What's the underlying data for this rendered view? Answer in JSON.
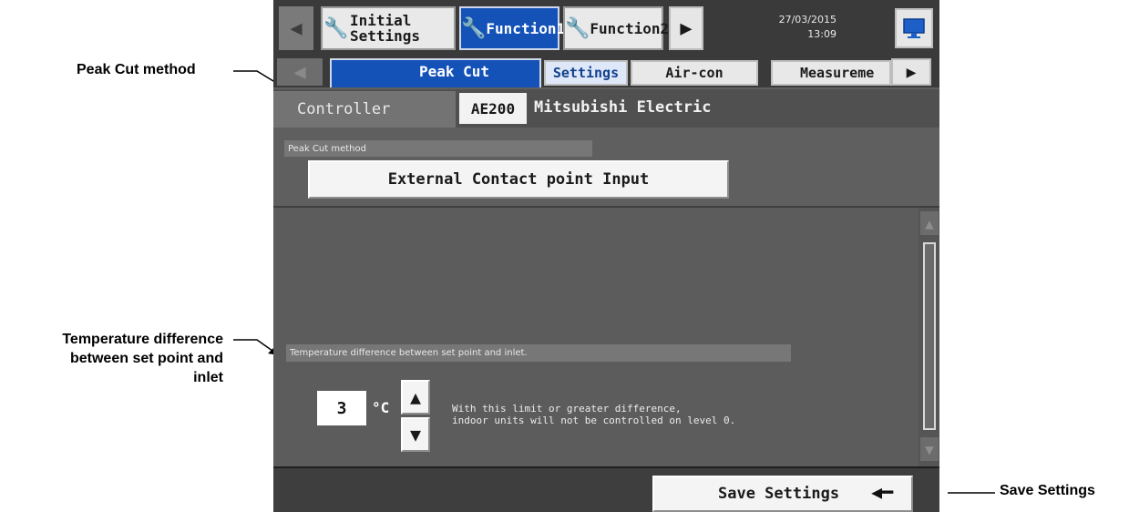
{
  "callouts": {
    "peak_cut_method": "Peak Cut method",
    "temperature_difference": [
      "Temperature difference",
      "between set point and",
      "inlet"
    ],
    "save_settings": "Save Settings"
  },
  "top_tabs": {
    "initial_settings": [
      "Initial",
      "Settings"
    ],
    "function1": "Function1",
    "function2": "Function2"
  },
  "datetime": {
    "date": "27/03/2015",
    "time": "13:09"
  },
  "sub_tabs": {
    "peak_cut": "Peak Cut",
    "settings": "Settings",
    "air_con": "Air-con",
    "measurement": "Measureme"
  },
  "controller": {
    "label": "Controller",
    "model": "AE200",
    "maker": "Mitsubishi Electric"
  },
  "peak_cut_method": {
    "label": "Peak Cut method",
    "value": "External Contact point Input"
  },
  "temperature": {
    "label": "Temperature difference between set point and inlet.",
    "value": "3",
    "unit": "°C",
    "note": [
      "With this limit or greater difference,",
      "indoor units will not be controlled on level 0."
    ]
  },
  "save_button": "Save Settings",
  "colors": {
    "accent": "#1452b8",
    "panel": "#5f5f5f",
    "bar": "#3a3a3a"
  }
}
